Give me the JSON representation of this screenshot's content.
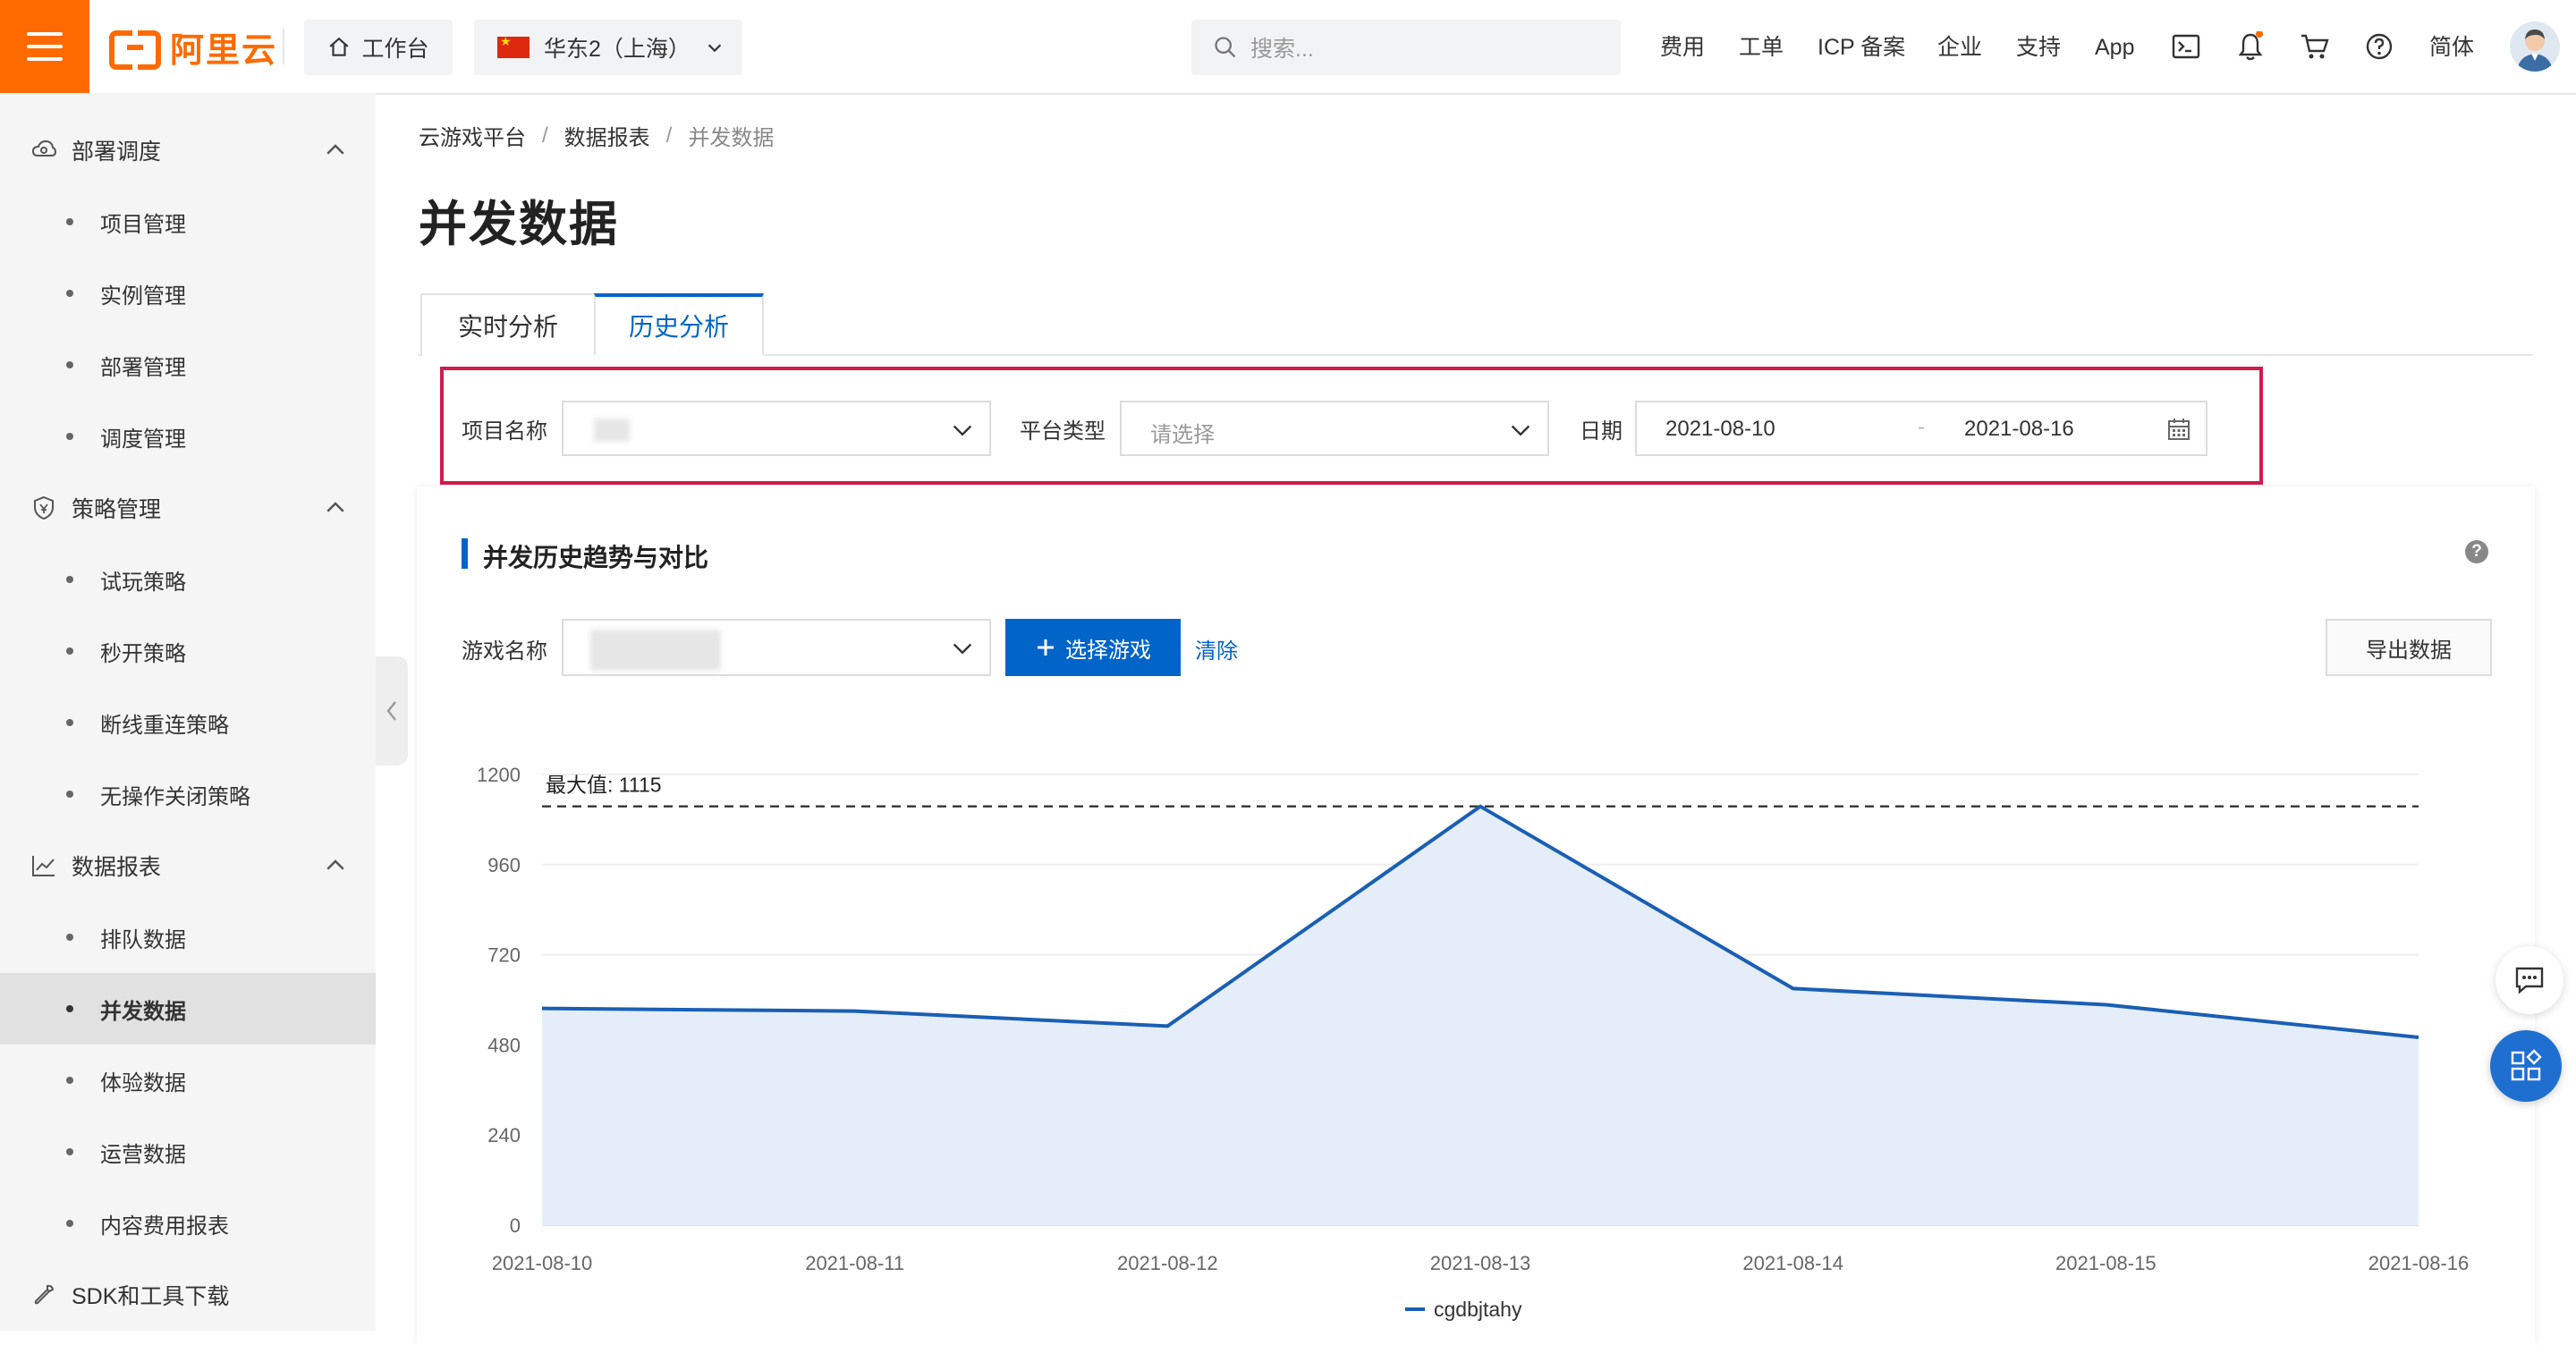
{
  "header": {
    "logo_text": "阿里云",
    "workbench_label": "工作台",
    "region_label": "华东2（上海）",
    "search_placeholder": "搜索...",
    "nav": [
      "费用",
      "工单",
      "ICP 备案",
      "企业",
      "支持",
      "App"
    ],
    "lang_label": "简体",
    "brand_color": "#ff6a00",
    "icons": [
      "terminal-icon",
      "bell-icon",
      "cart-icon",
      "help-icon"
    ]
  },
  "sidebar": {
    "groups": [
      {
        "label": "部署调度",
        "icon": "cloud-icon",
        "items": [
          "项目管理",
          "实例管理",
          "部署管理",
          "调度管理"
        ]
      },
      {
        "label": "策略管理",
        "icon": "shield-icon",
        "items": [
          "试玩策略",
          "秒开策略",
          "断线重连策略",
          "无操作关闭策略"
        ]
      },
      {
        "label": "数据报表",
        "icon": "chart-icon",
        "items": [
          "排队数据",
          "并发数据",
          "体验数据",
          "运营数据",
          "内容费用报表"
        ]
      }
    ],
    "active_item": "并发数据",
    "footer_label": "SDK和工具下载"
  },
  "breadcrumb": [
    "云游戏平台",
    "数据报表",
    "并发数据"
  ],
  "page_title": "并发数据",
  "tabs": {
    "realtime": "实时分析",
    "history": "历史分析",
    "active": "历史分析"
  },
  "filters": {
    "project_label": "项目名称",
    "platform_label": "平台类型",
    "platform_placeholder": "请选择",
    "date_label": "日期",
    "date_start": "2021-08-10",
    "date_separator": "-",
    "date_end": "2021-08-16"
  },
  "card": {
    "title": "并发历史趋势与对比",
    "game_label": "游戏名称",
    "select_game_button": "选择游戏",
    "clear_link": "清除",
    "export_button": "导出数据"
  },
  "chart_data": {
    "type": "area",
    "x": [
      "2021-08-10",
      "2021-08-11",
      "2021-08-12",
      "2021-08-13",
      "2021-08-14",
      "2021-08-15",
      "2021-08-16"
    ],
    "series": [
      {
        "name": "cgdbjtahy",
        "values": [
          577,
          570,
          530,
          1115,
          630,
          587,
          500
        ],
        "color": "#1a5fb4"
      }
    ],
    "yticks": [
      0,
      240,
      480,
      720,
      960,
      1200
    ],
    "ylim": [
      0,
      1200
    ],
    "max_line": {
      "value": 1115,
      "label": "最大值: 1115"
    },
    "fill_color": "#e5edf8",
    "legend_position": "bottom"
  }
}
